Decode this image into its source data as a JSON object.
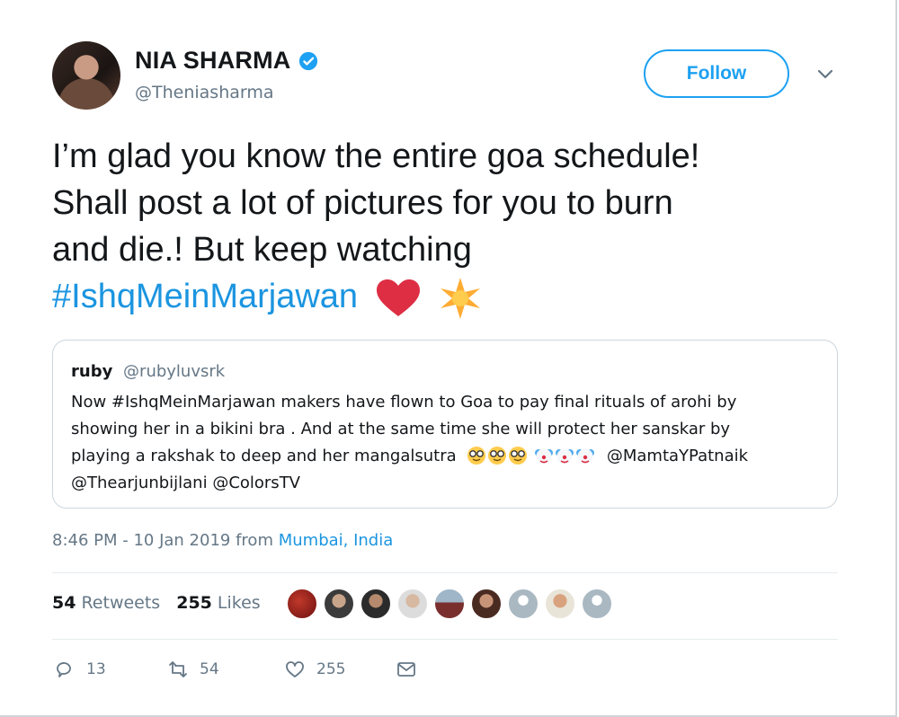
{
  "user": {
    "name": "NIA SHARMA",
    "handle": "@Theniasharma",
    "verified": true
  },
  "follow_label": "Follow",
  "tweet": {
    "lines": [
      "I’m glad you know the entire goa schedule!",
      "Shall post a lot of pictures for you to burn",
      "and die.! But keep watching"
    ],
    "hashtag": "#IshqMeinMarjawan",
    "emojis": [
      "red-heart",
      "sparkle-star"
    ]
  },
  "quoted": {
    "name": "ruby",
    "handle": "@rubyluvsrk",
    "line1": "Now #IshqMeinMarjawan makers have flown to Goa to pay final rituals of arohi by",
    "line2": "showing her in a bikini bra . And at the same time she will protect her sanskar by",
    "line3_text": "playing a rakshak to deep and her mangalsutra",
    "line3_mentions": "@MamtaYPatnaik",
    "line4": "@Thearjunbijlani @ColorsTV"
  },
  "meta": {
    "time": "8:46 PM - 10 Jan 2019 from",
    "location": "Mumbai, India"
  },
  "stats": {
    "retweets_count": "54",
    "retweets_label": "Retweets",
    "likes_count": "255",
    "likes_label": "Likes"
  },
  "actions": {
    "replies": "13",
    "retweets": "54",
    "likes": "255"
  },
  "colors": {
    "accent": "#1da1f2",
    "hashtag": "#1b95e0",
    "muted": "#657786",
    "text": "#14171a",
    "border": "#ccd6dd"
  }
}
